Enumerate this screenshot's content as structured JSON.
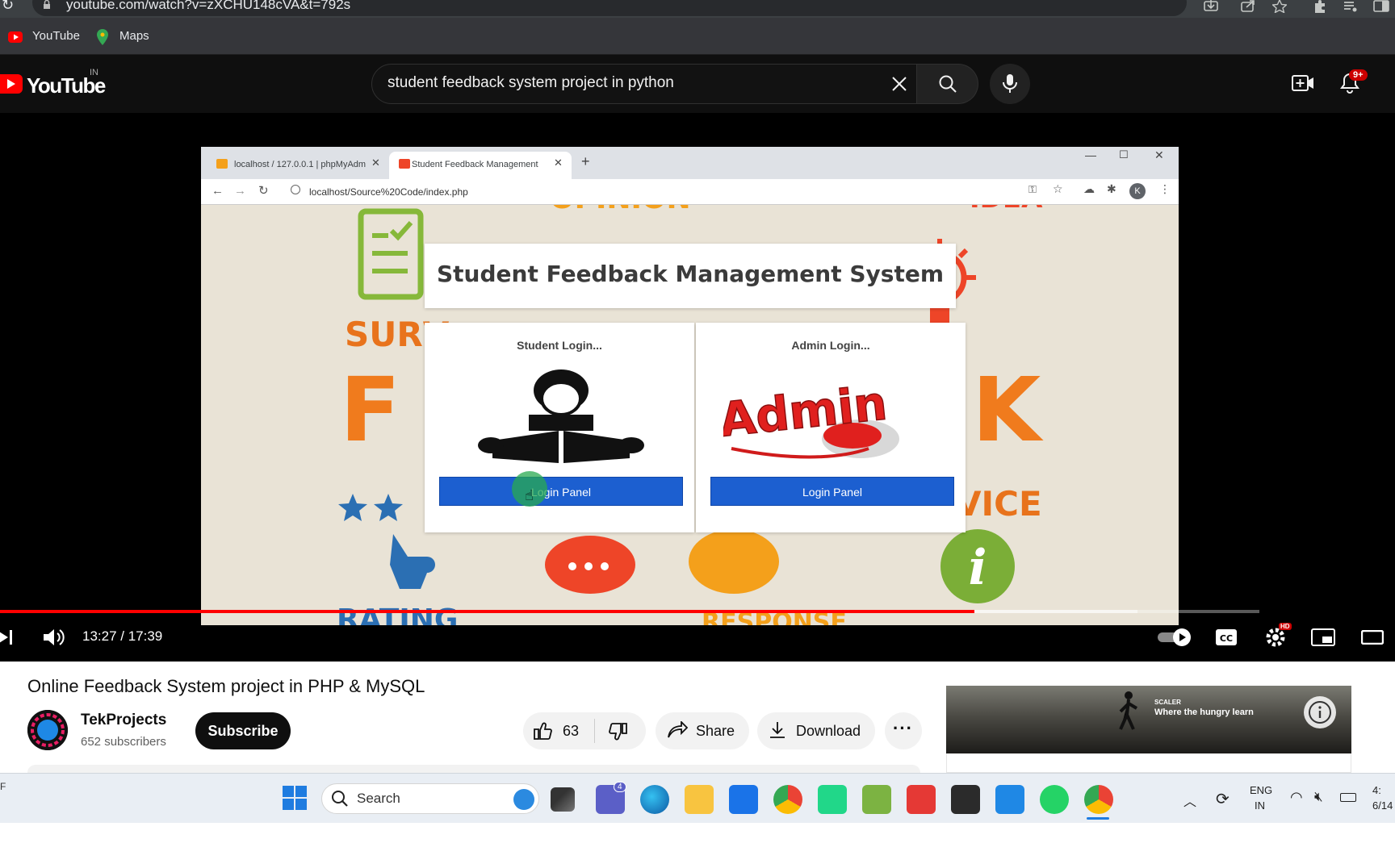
{
  "browser": {
    "url": "youtube.com/watch?v=zXCHU148cVA&t=792s",
    "bookmarks": [
      {
        "label": "YouTube"
      },
      {
        "label": "Maps"
      }
    ]
  },
  "header": {
    "logo_text": "YouTube",
    "region": "IN",
    "search_value": "student feedback system project in python",
    "notification_count": "9+"
  },
  "video": {
    "inner_browser": {
      "tabs": [
        {
          "label": "localhost / 127.0.0.1 | phpMyAdm"
        },
        {
          "label": "Student Feedback Management"
        }
      ],
      "url": "localhost/Source%20Code/index.php",
      "profile_initial": "K"
    },
    "page_title": "Student Feedback Management System",
    "panels": [
      {
        "label": "Student Login...",
        "button": "Login Panel"
      },
      {
        "label": "Admin Login...",
        "button": "Login Panel",
        "logo_text": "Admin"
      }
    ],
    "background_words": [
      "OPINION",
      "IDEA",
      "SURV",
      "F",
      "K",
      "VICE",
      "RATING",
      "RESPONSE"
    ],
    "time_display": "13:27 / 17:39",
    "progress": 0.7735,
    "buffered": 0.903
  },
  "details": {
    "title": "Online Feedback System project in PHP & MySQL",
    "channel": "TekProjects",
    "subscribers": "652 subscribers",
    "subscribe_label": "Subscribe",
    "likes": "63",
    "share_label": "Share",
    "download_label": "Download"
  },
  "ad": {
    "brand": "SCALER",
    "tagline": "Where the hungry learn"
  },
  "taskbar": {
    "search_label": "Search",
    "teams_badge": "4",
    "lang_line1": "ENG",
    "lang_line2": "IN",
    "clock_line1": "4:",
    "clock_line2": "6/14"
  },
  "colors": {
    "youtube_red": "#ff0000",
    "login_button": "#1c5fd0"
  }
}
